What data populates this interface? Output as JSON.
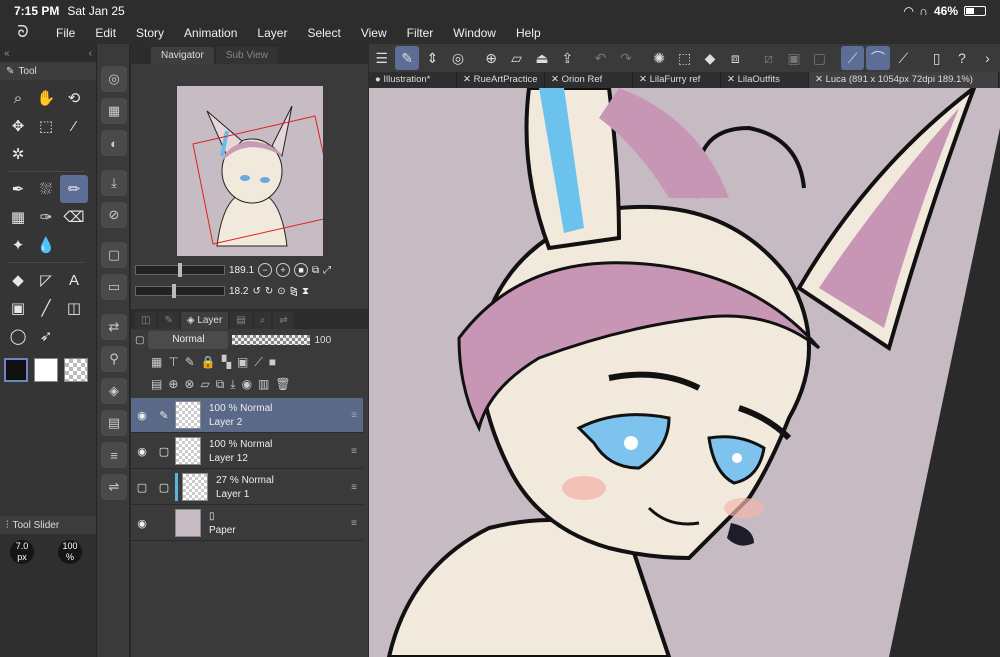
{
  "status": {
    "time": "7:15 PM",
    "date": "Sat Jan 25",
    "battery": "46%",
    "battery_level": 0.46
  },
  "menu": {
    "items": [
      "File",
      "Edit",
      "Story",
      "Animation",
      "Layer",
      "Select",
      "View",
      "Filter",
      "Window",
      "Help"
    ]
  },
  "tool_panel": {
    "tab": "Tool"
  },
  "tool_slider": {
    "title": "Tool Slider",
    "size_value": "7.0",
    "size_unit": "px",
    "opacity_value": "100",
    "opacity_unit": "%"
  },
  "navigator": {
    "tab": "Navigator",
    "tab2": "Sub View",
    "zoom": "189.1",
    "rotation": "18.2"
  },
  "layer_panel": {
    "tab": "Layer",
    "blend_mode": "Normal",
    "opacity": "100",
    "layers": [
      {
        "opacity_mode": "100 % Normal",
        "name": "Layer 2"
      },
      {
        "opacity_mode": "100 % Normal",
        "name": "Layer 12"
      },
      {
        "opacity_mode": "27 % Normal",
        "name": "Layer 1"
      },
      {
        "opacity_mode": "",
        "name": "Paper"
      }
    ]
  },
  "doc_tabs": [
    "Illustration*",
    "RueArtPractice",
    "Orion Ref",
    "LilaFurry ref",
    "LilaOutfits",
    "Luca (891 x 1054px 72dpi 189.1%)"
  ],
  "colors": {
    "accent": "#5c6e96",
    "selected_layer": "#5a6987",
    "paper": "#c6bac3"
  }
}
